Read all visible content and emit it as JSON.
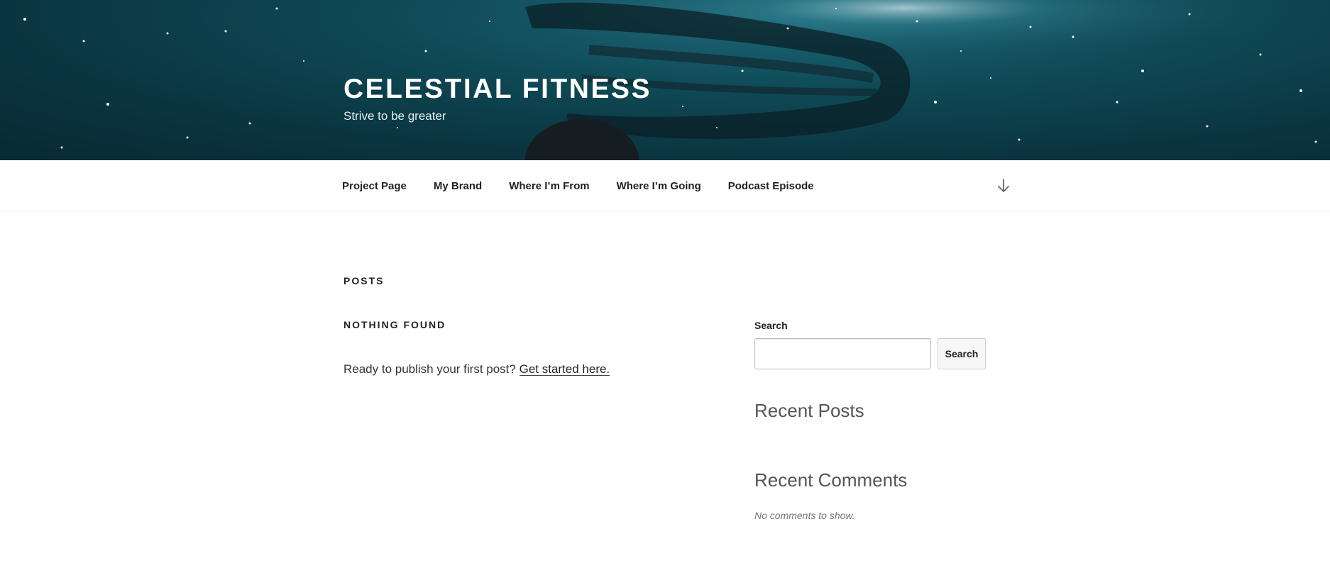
{
  "header": {
    "site_title": "CELESTIAL FITNESS",
    "tagline": "Strive to be greater"
  },
  "nav": {
    "items": [
      {
        "label": "Project Page"
      },
      {
        "label": "My Brand"
      },
      {
        "label": "Where I’m From"
      },
      {
        "label": "Where I’m Going"
      },
      {
        "label": "Podcast Episode"
      }
    ],
    "scroll_icon": "arrow-down-icon"
  },
  "main": {
    "page_title": "POSTS",
    "nothing_found_title": "NOTHING FOUND",
    "nothing_found_text": "Ready to publish your first post?",
    "get_started_link": "Get started here."
  },
  "sidebar": {
    "search_label": "Search",
    "search_placeholder": "",
    "search_button": "Search",
    "recent_posts_title": "Recent Posts",
    "recent_comments_title": "Recent Comments",
    "no_comments": "No comments to show."
  },
  "colors": {
    "hero_background": "#0f4a57",
    "text": "#222222",
    "widget_heading": "#555555"
  }
}
